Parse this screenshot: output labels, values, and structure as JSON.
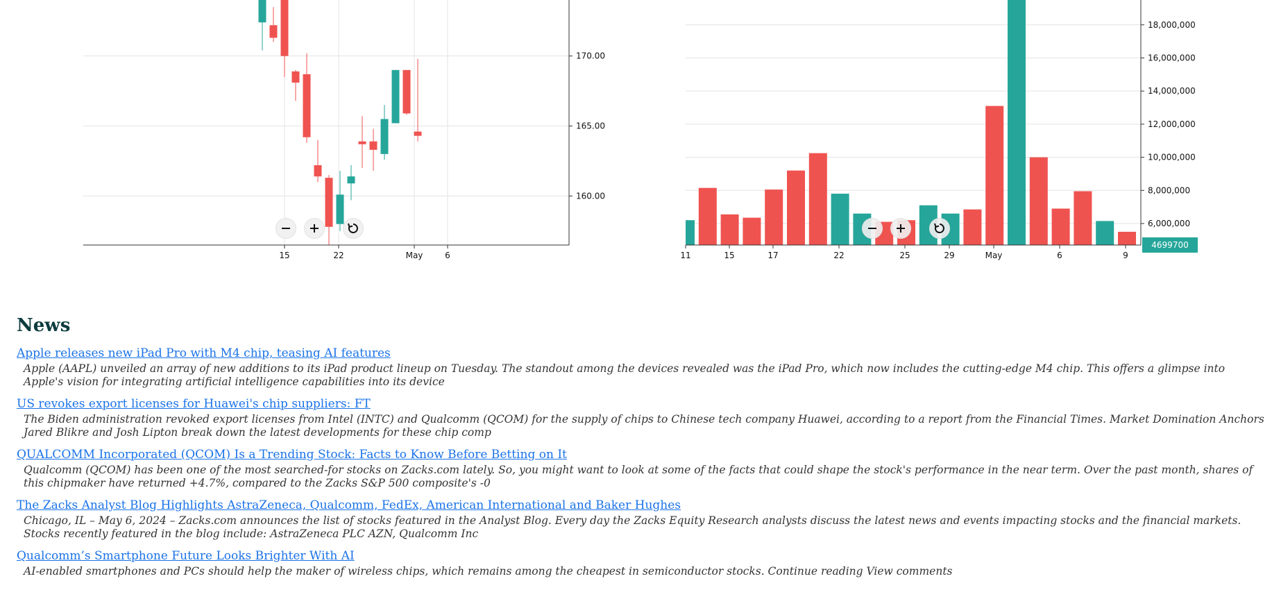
{
  "colors": {
    "up": "#26a69a",
    "down": "#ef5350",
    "grid": "#e3e3e3",
    "news_title": "#0d3b3e",
    "link": "#1a73e8"
  },
  "price_chart": {
    "controls": [
      "zoom-out",
      "zoom-in",
      "reset"
    ]
  },
  "volume_chart": {
    "last_value_label": "4699700",
    "controls": [
      "zoom-out",
      "zoom-in",
      "reset"
    ]
  },
  "chart_data": [
    {
      "type": "candlestick",
      "title": "",
      "ylabel": "",
      "ylim": [
        156.5,
        174
      ],
      "y_ticks": [
        "160.00",
        "165.00",
        "170.00"
      ],
      "x_ticks": [
        "15",
        "22",
        "May",
        "6"
      ],
      "candles": [
        {
          "x": 0,
          "open": 172.4,
          "high": 174.2,
          "low": 170.4,
          "close": 174.2,
          "dir": "up"
        },
        {
          "x": 1,
          "open": 172.2,
          "high": 173.5,
          "low": 171.0,
          "close": 171.3,
          "dir": "down"
        },
        {
          "x": 2,
          "open": 174.2,
          "high": 174.2,
          "low": 168.5,
          "close": 170.0,
          "dir": "down"
        },
        {
          "x": 3,
          "open": 168.9,
          "high": 169.0,
          "low": 166.8,
          "close": 168.1,
          "dir": "down"
        },
        {
          "x": 4,
          "open": 168.7,
          "high": 170.2,
          "low": 163.8,
          "close": 164.2,
          "dir": "down"
        },
        {
          "x": 5,
          "open": 162.2,
          "high": 164.0,
          "low": 161.0,
          "close": 161.4,
          "dir": "down"
        },
        {
          "x": 6,
          "open": 161.3,
          "high": 161.5,
          "low": 156.5,
          "close": 157.8,
          "dir": "down"
        },
        {
          "x": 7,
          "open": 158.0,
          "high": 161.8,
          "low": 157.5,
          "close": 160.1,
          "dir": "up"
        },
        {
          "x": 8,
          "open": 160.9,
          "high": 162.2,
          "low": 159.7,
          "close": 161.4,
          "dir": "up"
        },
        {
          "x": 9,
          "open": 163.9,
          "high": 165.7,
          "low": 162.0,
          "close": 163.7,
          "dir": "down"
        },
        {
          "x": 10,
          "open": 163.9,
          "high": 164.8,
          "low": 161.8,
          "close": 163.3,
          "dir": "down"
        },
        {
          "x": 11,
          "open": 163.0,
          "high": 166.5,
          "low": 162.6,
          "close": 165.5,
          "dir": "up"
        },
        {
          "x": 12,
          "open": 165.2,
          "high": 169.0,
          "low": 165.2,
          "close": 169.0,
          "dir": "up"
        },
        {
          "x": 13,
          "open": 169.0,
          "high": 169.0,
          "low": 165.8,
          "close": 165.9,
          "dir": "down"
        },
        {
          "x": 14,
          "open": 164.6,
          "high": 169.8,
          "low": 163.9,
          "close": 164.3,
          "dir": "down"
        }
      ]
    },
    {
      "type": "bar",
      "title": "",
      "ylabel": "",
      "ylim": [
        4699700,
        19500000
      ],
      "y_ticks": [
        "6,000,000",
        "8,000,000",
        "10,000,000",
        "12,000,000",
        "14,000,000",
        "16,000,000",
        "18,000,000"
      ],
      "x_ticks": [
        "11",
        "15",
        "17",
        "22",
        "25",
        "29",
        "May",
        "6",
        "9"
      ],
      "values": [
        6200000,
        8150000,
        6550000,
        6350000,
        8050000,
        9200000,
        10250000,
        7800000,
        6600000,
        6100000,
        6200000,
        7100000,
        6600000,
        6850000,
        13100000,
        19500000,
        10000000,
        6900000,
        7950000,
        6150000,
        5500000
      ],
      "directions": [
        "up",
        "down",
        "down",
        "down",
        "down",
        "down",
        "down",
        "up",
        "up",
        "down",
        "down",
        "up",
        "up",
        "down",
        "down",
        "up",
        "down",
        "down",
        "down",
        "up",
        "down"
      ]
    }
  ],
  "news": {
    "heading": "News",
    "items": [
      {
        "title": "Apple releases new iPad Pro with M4 chip, teasing AI features",
        "summary": "Apple (AAPL) unveiled an array of new additions to its iPad product lineup on Tuesday. The standout among the devices revealed was the iPad Pro, which now includes the cutting-edge M4 chip. This offers a glimpse into Apple's vision for integrating artificial intelligence capabilities into its device"
      },
      {
        "title": "US revokes export licenses for Huawei's chip suppliers: FT",
        "summary": "The Biden administration revoked export licenses from Intel (INTC) and Qualcomm (QCOM) for the supply of chips to Chinese tech company Huawei, according to a report from the Financial Times. Market Domination Anchors Jared Blikre and Josh Lipton break down the latest developments for these chip comp"
      },
      {
        "title": "QUALCOMM Incorporated (QCOM) Is a Trending Stock: Facts to Know Before Betting on It",
        "summary": "Qualcomm (QCOM) has been one of the most searched-for stocks on Zacks.com lately. So, you might want to look at some of the facts that could shape the stock's performance in the near term. Over the past month, shares of this chipmaker have returned +4.7%, compared to the Zacks S&P 500 composite's -0"
      },
      {
        "title": "The Zacks Analyst Blog Highlights AstraZeneca, Qualcomm, FedEx, American International and Baker Hughes",
        "summary": "Chicago, IL – May 6, 2024 – Zacks.com announces the list of stocks featured in the Analyst Blog. Every day the Zacks Equity Research analysts discuss the latest news and events impacting stocks and the financial markets. Stocks recently featured in the blog include: AstraZeneca PLC AZN, Qualcomm Inc"
      },
      {
        "title": "Qualcomm’s Smartphone Future Looks Brighter With AI",
        "summary": "AI-enabled smartphones and PCs should help the maker of wireless chips, which remains among the cheapest in semiconductor stocks. Continue reading View comments"
      }
    ]
  }
}
